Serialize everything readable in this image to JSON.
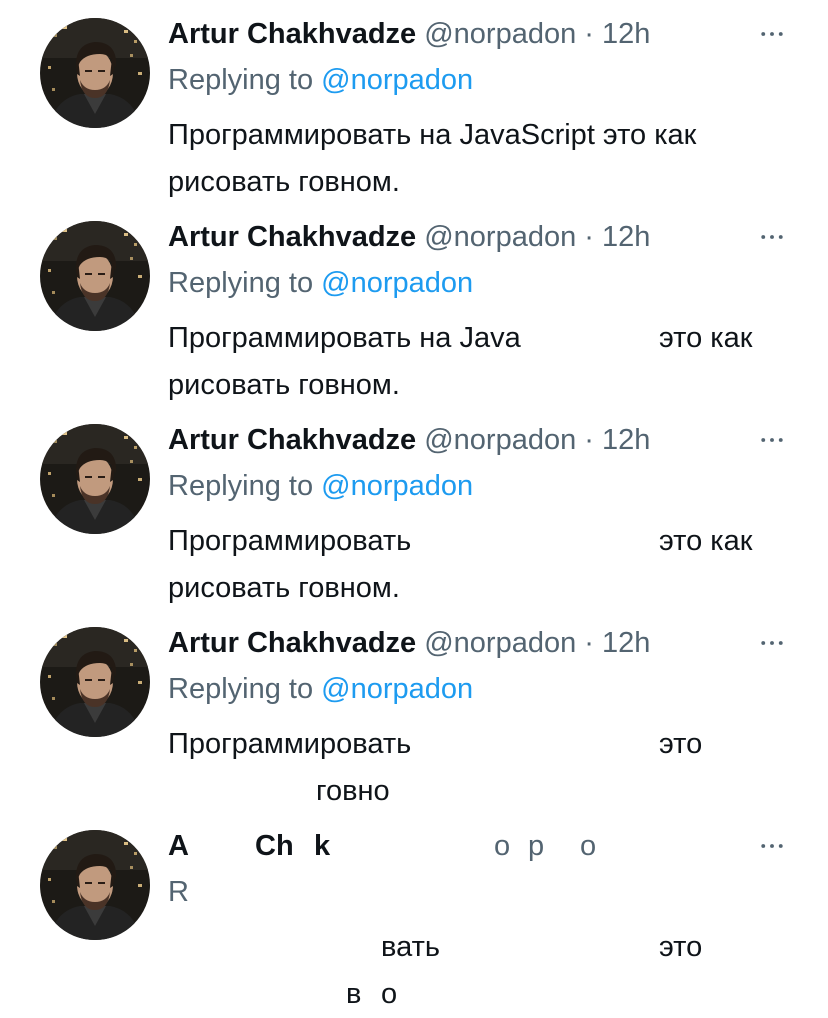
{
  "colors": {
    "text": "#0f1419",
    "secondary": "#536471",
    "link": "#1d9bf0",
    "background": "#ffffff"
  },
  "icons": {
    "more": "more-horizontal-icon",
    "avatar": "avatar-photo"
  },
  "tweets": [
    {
      "name": "Artur Chakhvadze",
      "handle": "@norpadon",
      "dot": "·",
      "time": "12h",
      "reply_prefix": "Replying to",
      "reply_mention": "@norpadon",
      "body_line1": "Программировать на JavaScript это как",
      "body_line2": "рисовать говном."
    },
    {
      "name": "Artur Chakhvadze",
      "handle": "@norpadon",
      "dot": "·",
      "time": "12h",
      "reply_prefix": "Replying to",
      "reply_mention": "@norpadon",
      "body_frag1": "Программировать на Java",
      "body_frag2": "это как",
      "body_line2": "рисовать говном."
    },
    {
      "name": "Artur Chakhvadze",
      "handle": "@norpadon",
      "dot": "·",
      "time": "12h",
      "reply_prefix": "Replying to",
      "reply_mention": "@norpadon",
      "body_frag1": "Программировать",
      "body_frag2": "это как",
      "body_line2": "рисовать говном."
    },
    {
      "name": "Artur Chakhvadze",
      "handle": "@norpadon",
      "dot": "·",
      "time": "12h",
      "reply_prefix": "Replying to",
      "reply_mention": "@norpadon",
      "body_frag1": "Программировать",
      "body_frag2": "это",
      "body_frag3": "говно"
    },
    {
      "name_frag1": "A",
      "name_frag2": "Ch",
      "name_frag3": "k",
      "handle_frag1": "o",
      "handle_frag2": "p",
      "handle_frag3": "o",
      "reply_frag": "R",
      "body_frag1": "вать",
      "body_frag2": "это",
      "body_frag3": "в",
      "body_frag4": "о"
    }
  ]
}
